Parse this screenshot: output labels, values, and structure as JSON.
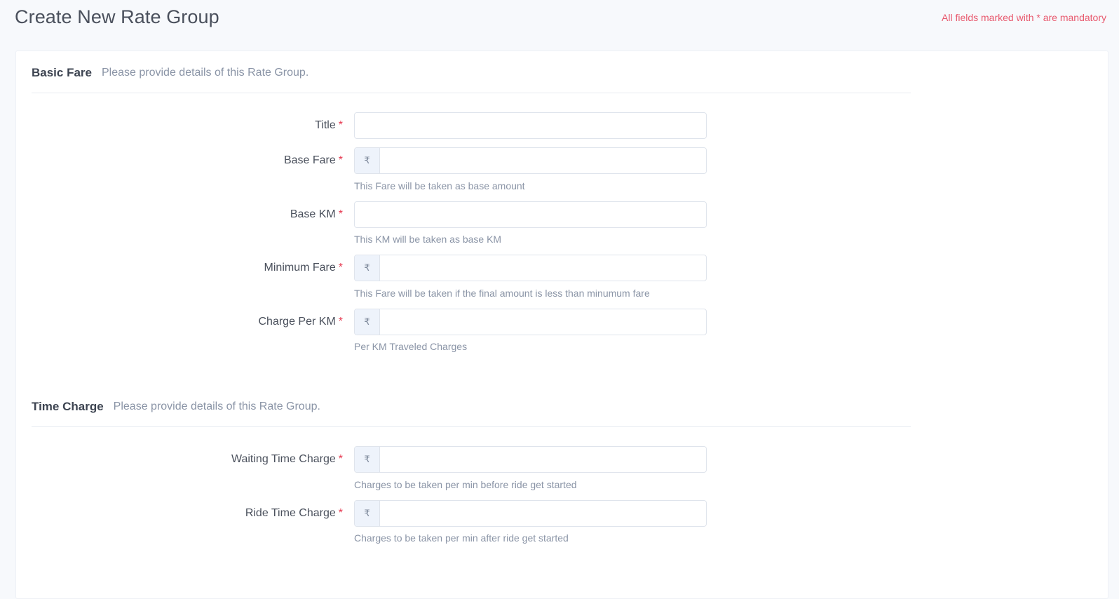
{
  "header": {
    "title": "Create New Rate Group",
    "mandatory_note": "All fields marked with * are mandatory"
  },
  "currency_symbol": "₹",
  "required_mark": "*",
  "sections": [
    {
      "title": "Basic Fare",
      "subtitle": "Please provide details of this Rate Group.",
      "fields": [
        {
          "label": "Title",
          "value": "",
          "placeholder": "",
          "hint": ""
        },
        {
          "label": "Base Fare",
          "value": "",
          "placeholder": "",
          "hint": "This Fare will be taken as base amount"
        },
        {
          "label": "Base KM",
          "value": "",
          "placeholder": "",
          "hint": "This KM will be taken as base KM"
        },
        {
          "label": "Minimum Fare",
          "value": "",
          "placeholder": "",
          "hint": "This Fare will be taken if the final amount is less than minumum fare"
        },
        {
          "label": "Charge Per KM",
          "value": "",
          "placeholder": "",
          "hint": "Per KM Traveled Charges"
        }
      ]
    },
    {
      "title": "Time Charge",
      "subtitle": "Please provide details of this Rate Group.",
      "fields": [
        {
          "label": "Waiting Time Charge",
          "value": "",
          "placeholder": "",
          "hint": "Charges to be taken per min before ride get started"
        },
        {
          "label": "Ride Time Charge",
          "value": "",
          "placeholder": "",
          "hint": "Charges to be taken per min after ride get started"
        }
      ]
    }
  ],
  "colors": {
    "background": "#f7f9fc",
    "card": "#ffffff",
    "required": "#e6384f",
    "mandatory_note": "#e8596e",
    "hint": "#8a94a6",
    "addon_bg": "#eef3fb"
  }
}
